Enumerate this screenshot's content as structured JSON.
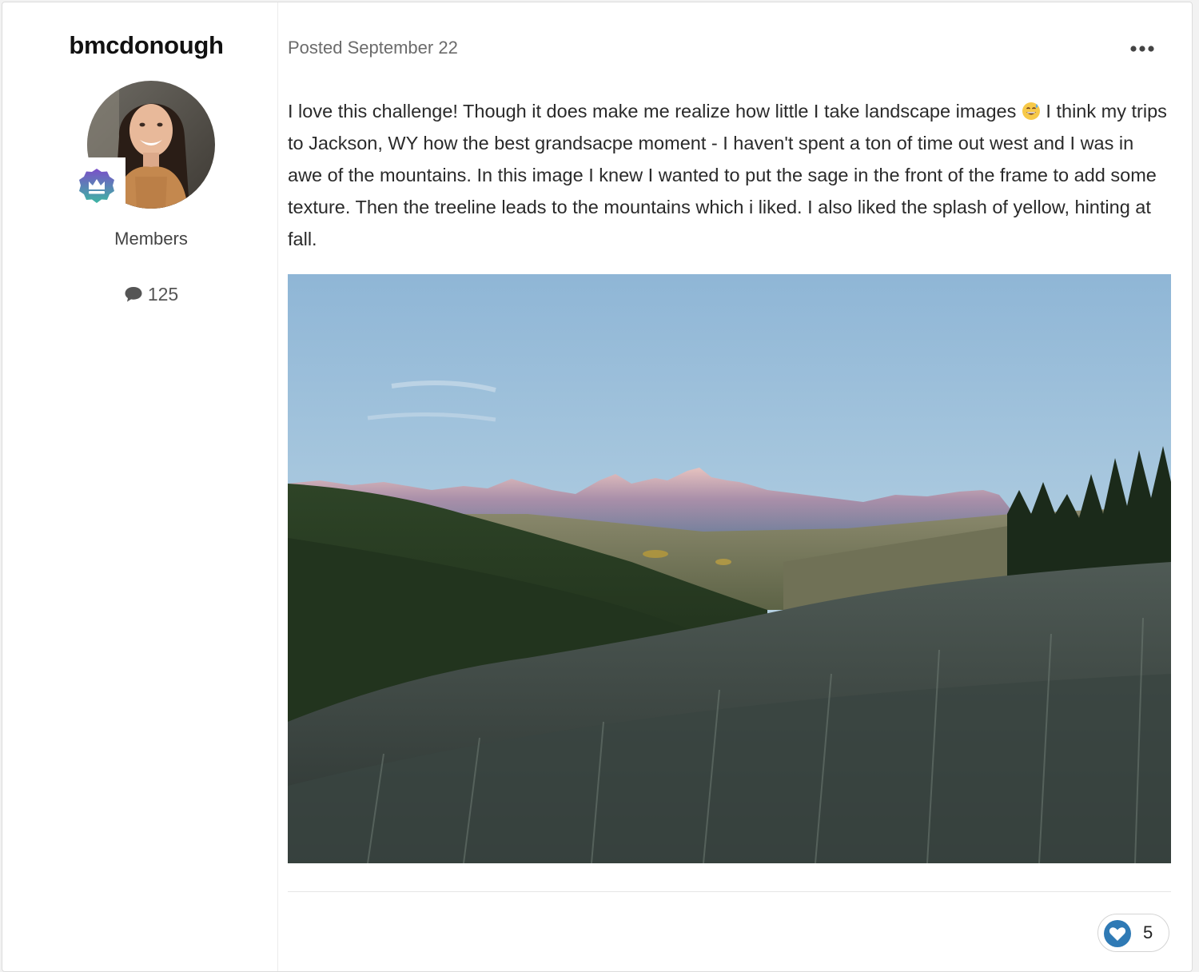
{
  "author": {
    "username": "bmcdonough",
    "group": "Members",
    "post_count": "125"
  },
  "post": {
    "posted_label": "Posted September 22",
    "body_before_emoji": "I love this challenge! Though it does make me realize how little I take landscape images ",
    "body_after_emoji": " I think my trips to Jackson, WY how the best grandsacpe moment - I haven't spent a ton of time out west and I was in awe of the mountains. In this image I knew I wanted to put the sage in the front of the frame to add some texture. Then the treeline leads to the mountains which i liked. I also liked the splash of yellow, hinting at fall.",
    "emoji": "grinning-sweat-emoji"
  },
  "reactions": {
    "icon": "heart-icon",
    "count": "5"
  },
  "icons": {
    "menu": "ellipsis-icon",
    "badge": "crown-badge-icon",
    "posts": "speech-bubble-icon"
  },
  "colors": {
    "reaction_heart": "#2f7ab5",
    "badge_top": "#7b4fc9",
    "badge_bottom": "#3db5a3"
  }
}
